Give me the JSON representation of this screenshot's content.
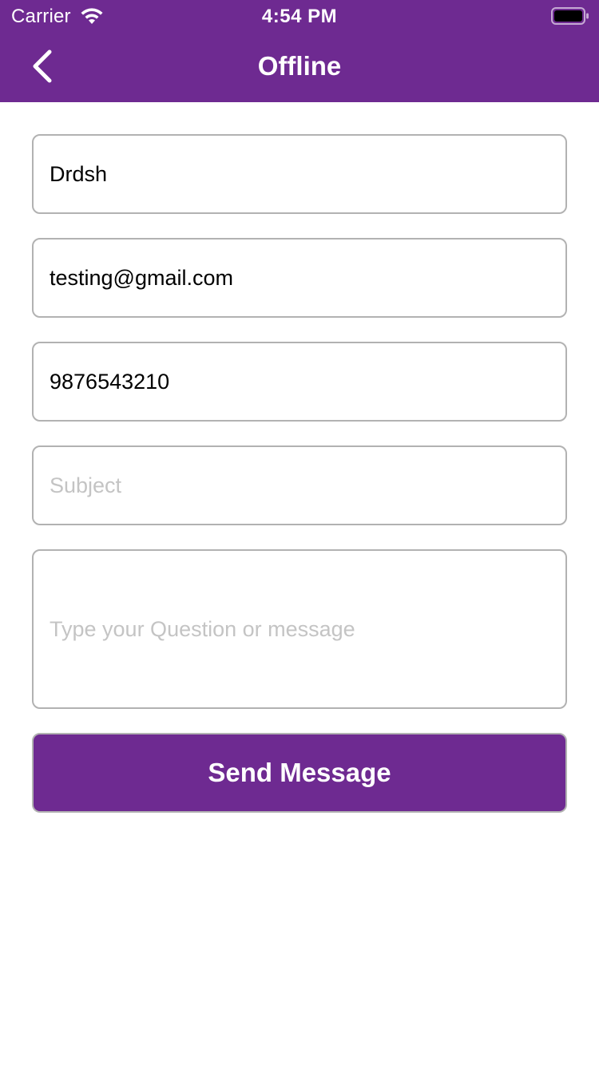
{
  "colors": {
    "brand": "#6e2a91",
    "border": "#b2b2b2",
    "placeholder": "#c4c4c4"
  },
  "status_bar": {
    "carrier": "Carrier",
    "time": "4:54 PM",
    "icons": [
      "wifi-icon",
      "battery-icon"
    ]
  },
  "navbar": {
    "back_icon": "chevron-left-icon",
    "title": "Offline"
  },
  "form": {
    "name": {
      "value": "Drdsh",
      "placeholder": ""
    },
    "email": {
      "value": "testing@gmail.com",
      "placeholder": ""
    },
    "phone": {
      "value": "9876543210",
      "placeholder": ""
    },
    "subject": {
      "value": "",
      "placeholder": "Subject"
    },
    "message": {
      "value": "",
      "placeholder": "Type your Question or message"
    },
    "submit_label": "Send Message"
  }
}
